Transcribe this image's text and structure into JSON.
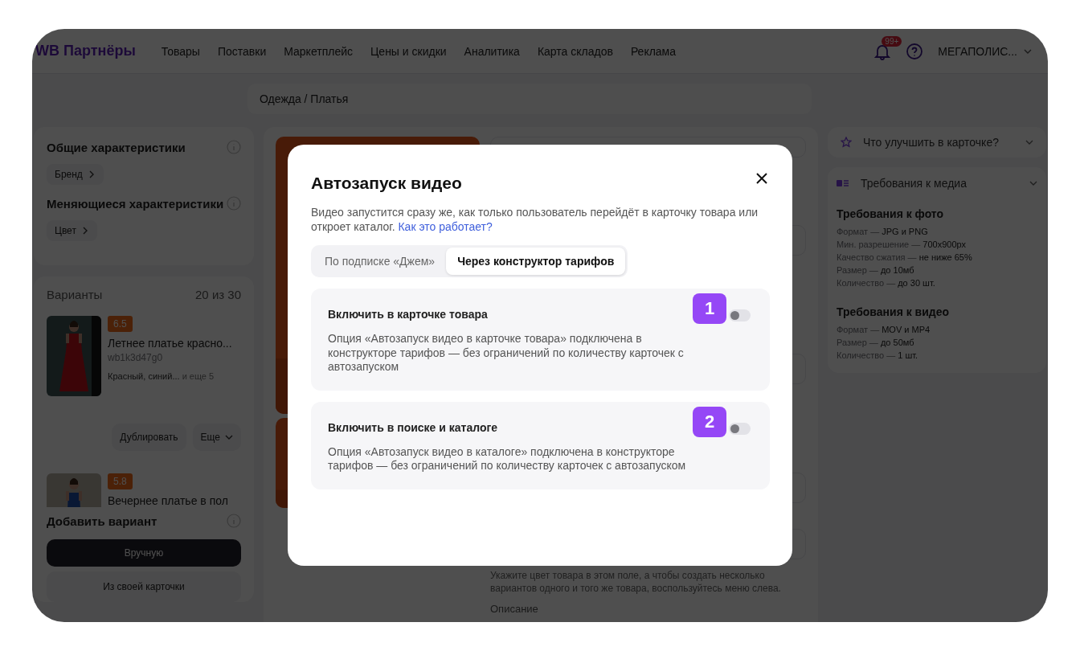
{
  "header": {
    "logo": "WB Партнёры",
    "nav": [
      "Товары",
      "Поставки",
      "Маркетплейс",
      "Цены и скидки",
      "Аналитика",
      "Карта складов",
      "Реклама"
    ],
    "notifications_badge": "99+",
    "account": "МЕГАПОЛИС..."
  },
  "breadcrumb": "Одежда / Платья",
  "characteristics": [
    {
      "title": "Общие характеристики",
      "chip": "Бренд"
    },
    {
      "title": "Меняющиеся характеристики",
      "chip": "Цвет"
    }
  ],
  "variants": {
    "title": "Варианты",
    "count": "20 из 30",
    "items": [
      {
        "rating": "6.5",
        "name": "Летнее платье красно...",
        "sku": "wb1k3d47g0",
        "colors": "Красный, синий...",
        "more": "и еще 5"
      },
      {
        "rating": "5.8",
        "name": "Вечернее платье в пол"
      }
    ],
    "actions": [
      "Дублировать",
      "Еще"
    ]
  },
  "add_variant": {
    "title": "Добавить вариант",
    "primary": "Вручную",
    "secondary": "Из своей карточки"
  },
  "form": {
    "hint": "Укажите цвет товара в этом поле, а чтобы создать несколько вариантов одного и того же товара, воспользуйтесь меню слева.",
    "label": "Описание"
  },
  "aside": {
    "improve": "Что улучшить в карточке?",
    "media": {
      "title": "Требования к медиа",
      "groups": [
        {
          "title": "Требования к фото",
          "rows": [
            {
              "label": "Формат —",
              "value": "JPG и PNG"
            },
            {
              "label": "Мин. разрешение —",
              "value": "700x900px"
            },
            {
              "label": "Качество сжатия —",
              "value": "не ниже 65%"
            },
            {
              "label": "Размер —",
              "value": "до 10мб"
            },
            {
              "label": "Количество —",
              "value": "до 30 шт."
            }
          ]
        },
        {
          "title": "Требования к видео",
          "rows": [
            {
              "label": "Формат —",
              "value": "MOV и MP4"
            },
            {
              "label": "Размер —",
              "value": "до 50мб"
            },
            {
              "label": "Количество —",
              "value": "1 шт."
            }
          ]
        }
      ]
    }
  },
  "modal": {
    "title": "Автозапуск видео",
    "description": "Видео запустится сразу же, как только пользователь перейдёт в карточку товара или откроет каталог.",
    "link": "Как это работает?",
    "tabs": [
      {
        "label": "По подписке «Джем»",
        "selected": false
      },
      {
        "label": "Через конструктор тарифов",
        "selected": true
      }
    ],
    "options": [
      {
        "badge": "1",
        "title": "Включить в карточке товара",
        "text": "Опция «Автозапуск видео в карточке товара» подключена в конструкторе тарифов — без ограничений по количеству карточек с автозапуском",
        "on": false
      },
      {
        "badge": "2",
        "title": "Включить в поиске и каталоге",
        "text": "Опция «Автозапуск видео в каталоге» подключена в конструкторе тарифов — без ограничений по количеству карточек с автозапуском",
        "on": false
      }
    ]
  }
}
